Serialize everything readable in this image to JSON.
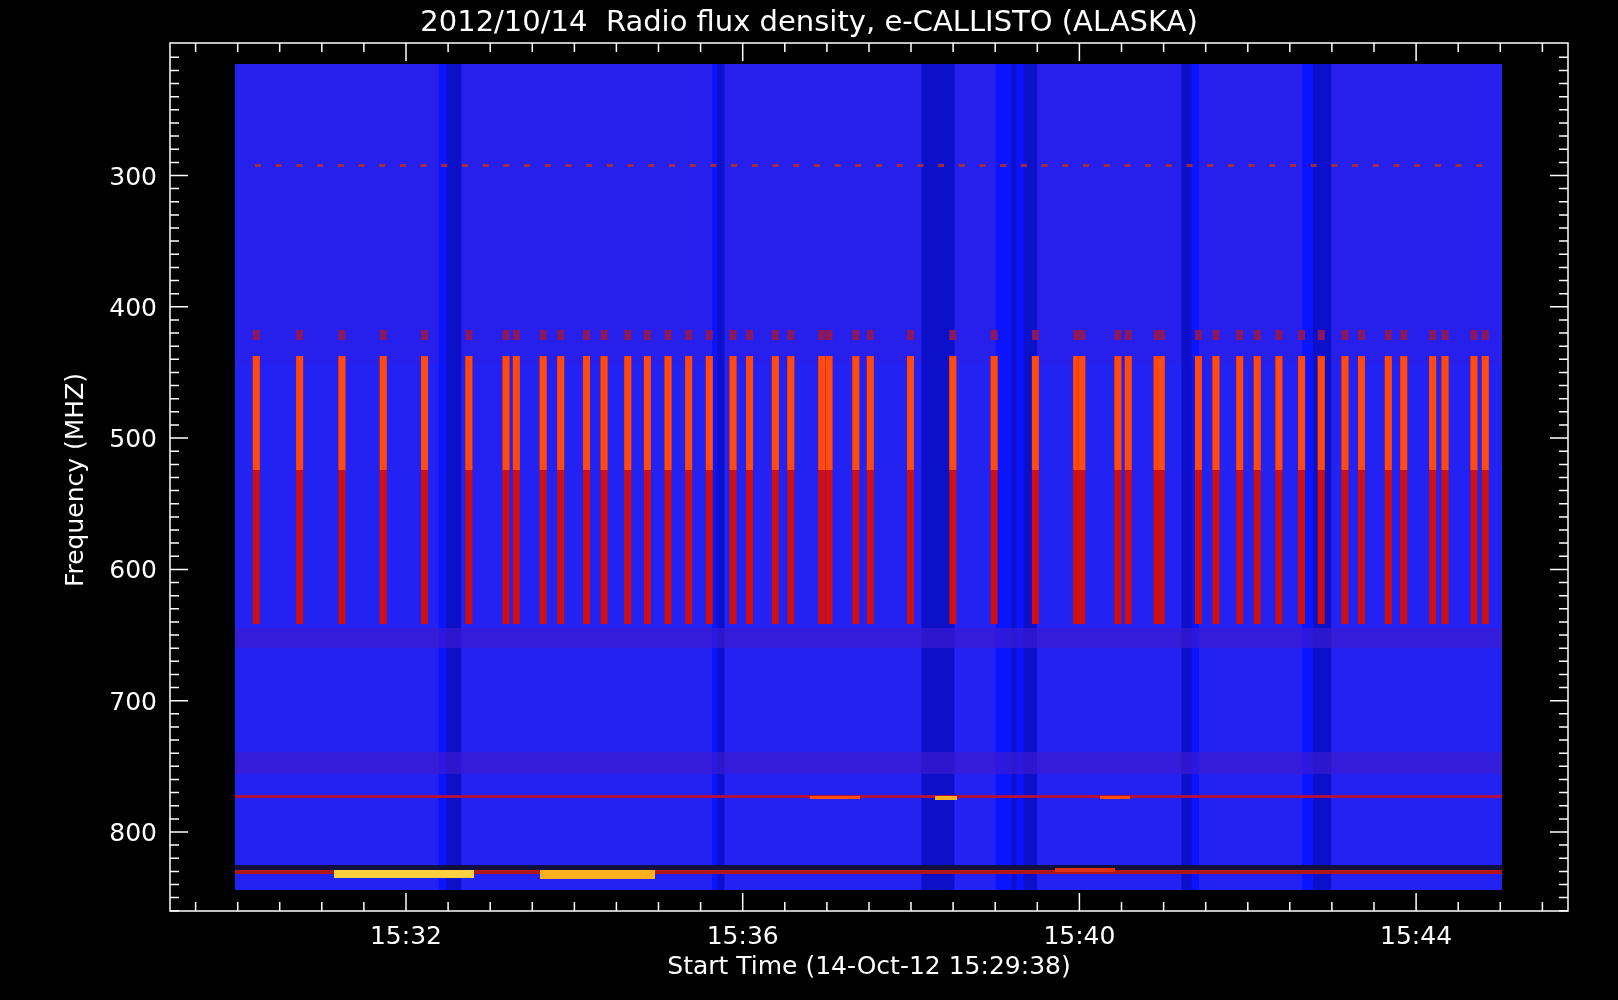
{
  "title": "2012/10/14  Radio flux density, e-CALLISTO (ALASKA)",
  "plot": {
    "ylabel": "Frequency (MHZ)",
    "xlabel": "Start Time (14-Oct-12 15:29:38)",
    "yticks": [
      {
        "label": "300"
      },
      {
        "label": "400"
      },
      {
        "label": "500"
      },
      {
        "label": "600"
      },
      {
        "label": "700"
      },
      {
        "label": "800"
      }
    ],
    "xticks": [
      {
        "label": "15:32"
      },
      {
        "label": "15:36"
      },
      {
        "label": "15:40"
      },
      {
        "label": "15:44"
      }
    ]
  }
}
